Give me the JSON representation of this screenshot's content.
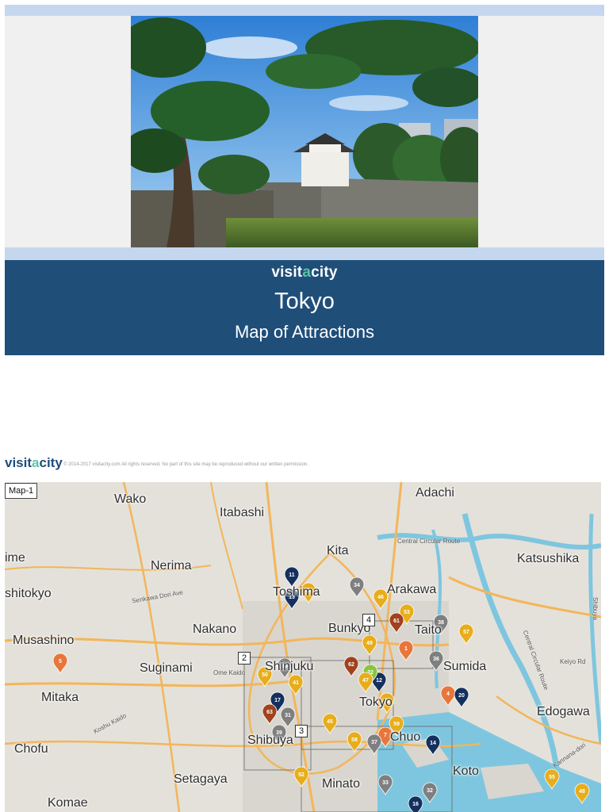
{
  "header": {
    "brand_prefix": "visit",
    "brand_accent": "a",
    "brand_suffix": "city",
    "city": "Tokyo",
    "subtitle": "Map of Attractions"
  },
  "footer_bar": {
    "brand_prefix": "visit",
    "brand_accent": "a",
    "brand_suffix": "city",
    "copyright": "© 2014-2017 visitacity.com All rights reserved. No part of this site may be reproduced without our written permission."
  },
  "map": {
    "label": "Map-1",
    "places": [
      "Wako",
      "Itabashi",
      "Adachi",
      "Kita",
      "Katsushika",
      "ime",
      "Nerima",
      "shitokyo",
      "Toshima",
      "Arakawa",
      "Nakano",
      "Bunkyo",
      "Taito",
      "Musashino",
      "Suginami",
      "Shinjuku",
      "Sumida",
      "Mitaka",
      "Tokyo",
      "Edogawa",
      "Shibuya",
      "Chuo",
      "Chofu",
      "Setagaya",
      "Koto",
      "Minato",
      "Komae"
    ],
    "roads": [
      "Senkawa Dori Ave",
      "Central Circular Route",
      "Ome Kaido",
      "Koshu Kaido",
      "Keiyo Rd",
      "Central Circular Route",
      "Kannana-dori",
      "Shibuya"
    ],
    "region_boxes": [
      "2",
      "3",
      "4"
    ],
    "colors": {
      "orange": "#e8763a",
      "yellow": "#e7ad1a",
      "navy": "#14305e",
      "gray": "#7f7f7f",
      "brown": "#a0421c",
      "green": "#8ac43f",
      "water": "#7ec6df",
      "highway": "#f2b65a"
    },
    "markers": [
      {
        "id": "1",
        "color": "orange"
      },
      {
        "id": "4",
        "color": "orange"
      },
      {
        "id": "5",
        "color": "orange"
      },
      {
        "id": "7",
        "color": "orange"
      },
      {
        "id": "11",
        "color": "navy"
      },
      {
        "id": "12",
        "color": "navy"
      },
      {
        "id": "13",
        "color": "navy"
      },
      {
        "id": "14",
        "color": "navy"
      },
      {
        "id": "16",
        "color": "navy"
      },
      {
        "id": "17",
        "color": "navy"
      },
      {
        "id": "20",
        "color": "navy"
      },
      {
        "id": "22",
        "color": "green"
      },
      {
        "id": "31",
        "color": "gray"
      },
      {
        "id": "32",
        "color": "gray"
      },
      {
        "id": "33",
        "color": "gray"
      },
      {
        "id": "34",
        "color": "gray"
      },
      {
        "id": "36",
        "color": "gray"
      },
      {
        "id": "37",
        "color": "gray"
      },
      {
        "id": "38",
        "color": "gray"
      },
      {
        "id": "39",
        "color": "gray"
      },
      {
        "id": "40",
        "color": "gray"
      },
      {
        "id": "41",
        "color": "yellow"
      },
      {
        "id": "44",
        "color": "yellow"
      },
      {
        "id": "45",
        "color": "yellow"
      },
      {
        "id": "46",
        "color": "yellow"
      },
      {
        "id": "47",
        "color": "yellow"
      },
      {
        "id": "48",
        "color": "yellow"
      },
      {
        "id": "49",
        "color": "yellow"
      },
      {
        "id": "50",
        "color": "yellow"
      },
      {
        "id": "51",
        "color": "yellow"
      },
      {
        "id": "52",
        "color": "yellow"
      },
      {
        "id": "53",
        "color": "yellow"
      },
      {
        "id": "55",
        "color": "yellow"
      },
      {
        "id": "57",
        "color": "yellow"
      },
      {
        "id": "58",
        "color": "yellow"
      },
      {
        "id": "59",
        "color": "yellow"
      },
      {
        "id": "61",
        "color": "brown"
      },
      {
        "id": "62",
        "color": "brown"
      },
      {
        "id": "63",
        "color": "brown"
      }
    ]
  }
}
